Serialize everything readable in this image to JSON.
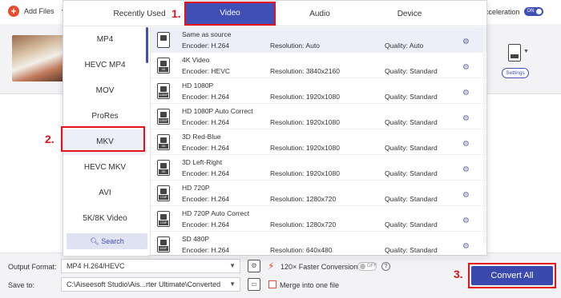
{
  "toolbar": {
    "add_files": "Add Files",
    "acceleration": "cceleration",
    "accel_toggle": "ON"
  },
  "file": {
    "settings": "Settings"
  },
  "popup": {
    "tabs": [
      "Recently Used",
      "Video",
      "Audio",
      "Device"
    ],
    "active_tab": "Video",
    "formats": [
      "MP4",
      "HEVC MP4",
      "MOV",
      "ProRes",
      "MKV",
      "HEVC MKV",
      "AVI",
      "5K/8K Video"
    ],
    "active_format": "MKV",
    "search": "Search",
    "presets": [
      {
        "name": "Same as source",
        "encoder": "Encoder: H.264",
        "resolution": "Resolution: Auto",
        "quality": "Quality: Auto",
        "tag": ""
      },
      {
        "name": "4K Video",
        "encoder": "Encoder: HEVC",
        "resolution": "Resolution: 3840x2160",
        "quality": "Quality: Standard",
        "tag": "4K"
      },
      {
        "name": "HD 1080P",
        "encoder": "Encoder: H.264",
        "resolution": "Resolution: 1920x1080",
        "quality": "Quality: Standard",
        "tag": "1080P"
      },
      {
        "name": "HD 1080P Auto Correct",
        "encoder": "Encoder: H.264",
        "resolution": "Resolution: 1920x1080",
        "quality": "Quality: Standard",
        "tag": "1080P"
      },
      {
        "name": "3D Red-Blue",
        "encoder": "Encoder: H.264",
        "resolution": "Resolution: 1920x1080",
        "quality": "Quality: Standard",
        "tag": "3D"
      },
      {
        "name": "3D Left-Right",
        "encoder": "Encoder: H.264",
        "resolution": "Resolution: 1920x1080",
        "quality": "Quality: Standard",
        "tag": "3D"
      },
      {
        "name": "HD 720P",
        "encoder": "Encoder: H.264",
        "resolution": "Resolution: 1280x720",
        "quality": "Quality: Standard",
        "tag": "720P"
      },
      {
        "name": "HD 720P Auto Correct",
        "encoder": "Encoder: H.264",
        "resolution": "Resolution: 1280x720",
        "quality": "Quality: Standard",
        "tag": "720P"
      },
      {
        "name": "SD 480P",
        "encoder": "Encoder: H.264",
        "resolution": "Resolution: 640x480",
        "quality": "Quality: Standard",
        "tag": "480P"
      }
    ]
  },
  "bottom": {
    "output_format_label": "Output Format:",
    "output_format_value": "MP4 H.264/HEVC",
    "save_to_label": "Save to:",
    "save_to_value": "C:\\Aiseesoft Studio\\Ais...rter Ultimate\\Converted",
    "faster": "120× Faster Conversion",
    "faster_toggle": "OFF",
    "merge": "Merge into one file",
    "convert_all": "Convert All"
  },
  "steps": [
    "1.",
    "2.",
    "3."
  ],
  "colors": {
    "accent": "#3f4fb5",
    "highlight": "#e4121a",
    "brand_red": "#e84a32"
  }
}
